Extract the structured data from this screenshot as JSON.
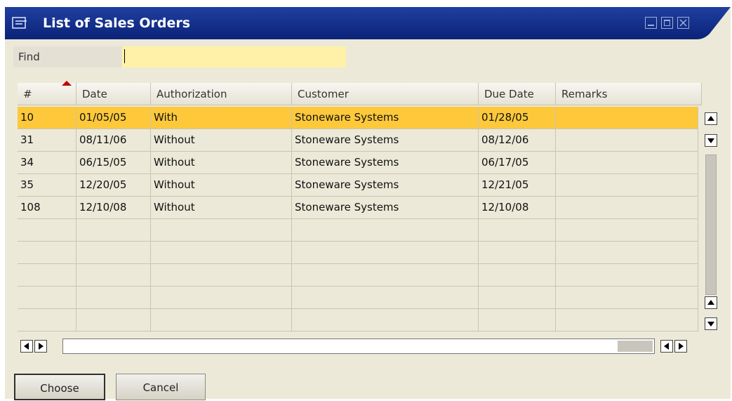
{
  "window": {
    "title": "List of Sales Orders",
    "icon": "form-list-icon",
    "controls": [
      "minimize-icon",
      "maximize-icon",
      "close-icon"
    ]
  },
  "find": {
    "label": "Find",
    "value": ""
  },
  "table": {
    "columns": [
      "#",
      "Date",
      "Authorization",
      "Customer",
      "Due Date",
      "Remarks"
    ],
    "sorted_column": "#",
    "rows": [
      {
        "num": "10",
        "date": "01/05/05",
        "authorization": "With",
        "customer": "Stoneware Systems",
        "due_date": "01/28/05",
        "remarks": ""
      },
      {
        "num": "31",
        "date": "08/11/06",
        "authorization": "Without",
        "customer": "Stoneware Systems",
        "due_date": "08/12/06",
        "remarks": ""
      },
      {
        "num": "34",
        "date": "06/15/05",
        "authorization": "Without",
        "customer": "Stoneware Systems",
        "due_date": "06/17/05",
        "remarks": ""
      },
      {
        "num": "35",
        "date": "12/20/05",
        "authorization": "Without",
        "customer": "Stoneware Systems",
        "due_date": "12/21/05",
        "remarks": ""
      },
      {
        "num": "108",
        "date": "12/10/08",
        "authorization": "Without",
        "customer": "Stoneware Systems",
        "due_date": "12/10/08",
        "remarks": ""
      }
    ],
    "selected_row": 0
  },
  "buttons": {
    "choose": "Choose",
    "cancel": "Cancel"
  },
  "colors": {
    "title_bar": "#0d2a80",
    "selected_row": "#fdc93a",
    "find_field": "#fff1a8",
    "window_bg": "#ece9d8"
  }
}
